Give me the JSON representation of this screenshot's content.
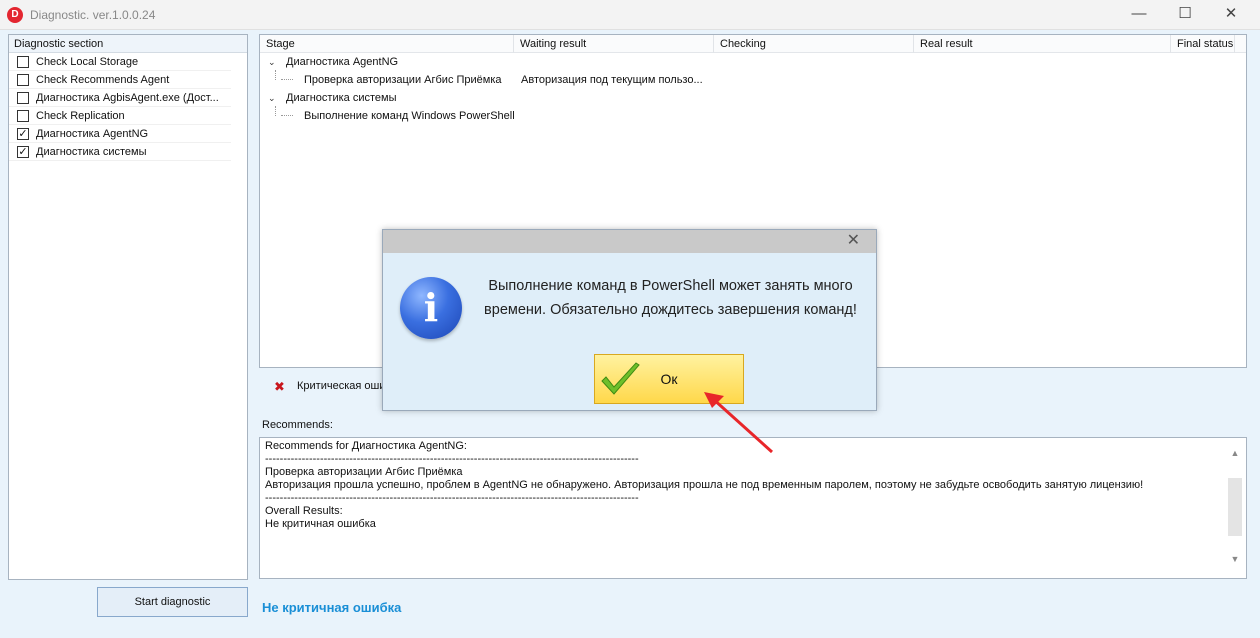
{
  "window": {
    "title": "Diagnostic. ver.1.0.0.24",
    "app_icon_letter": "D"
  },
  "sections": {
    "header": "Diagnostic section",
    "items": [
      {
        "label": "Check Local Storage",
        "checked": false
      },
      {
        "label": "Check Recommends Agent",
        "checked": false
      },
      {
        "label": "Диагностика AgbisAgent.exe (Дост...",
        "checked": false
      },
      {
        "label": "Check Replication",
        "checked": false
      },
      {
        "label": "Диагностика AgentNG",
        "checked": true
      },
      {
        "label": "Диагностика системы",
        "checked": true
      }
    ]
  },
  "grid": {
    "columns": [
      "Stage",
      "Waiting result",
      "Checking",
      "Real result",
      "Final status"
    ],
    "rows": [
      {
        "stage": "Диагностика AgentNG"
      },
      {
        "stage": "Проверка авторизации Агбис Приёмка",
        "waiting": "Авторизация под текущим пользо..."
      },
      {
        "stage": "Диагностика системы"
      },
      {
        "stage": "Выполнение команд Windows PowerShell"
      }
    ]
  },
  "status": {
    "text": "Критическая оши"
  },
  "recommends": {
    "label": "Recommends:",
    "lines": [
      "Recommends for Диагностика AgentNG:",
      "------------------------------------------------------------------------------------------------------",
      "Проверка авторизации Агбис Приёмка",
      "Авторизация прошла успешно, проблем в AgentNG не обнаружено. Авторизация прошла не под временным паролем, поэтому не забудьте освободить занятую лицензию!",
      "------------------------------------------------------------------------------------------------------",
      "Overall Results:",
      "Не критичная ошибка"
    ]
  },
  "bottom": {
    "start_button": "Start diagnostic",
    "result": "Не критичная ошибка",
    "result_color": "#1a8fd6"
  },
  "dialog": {
    "message_line1": "Выполнение команд в PowerShell может занять много",
    "message_line2": "времени. Обязательно дождитесь завершения команд!",
    "ok_label": "Ок",
    "info_glyph": "i"
  }
}
